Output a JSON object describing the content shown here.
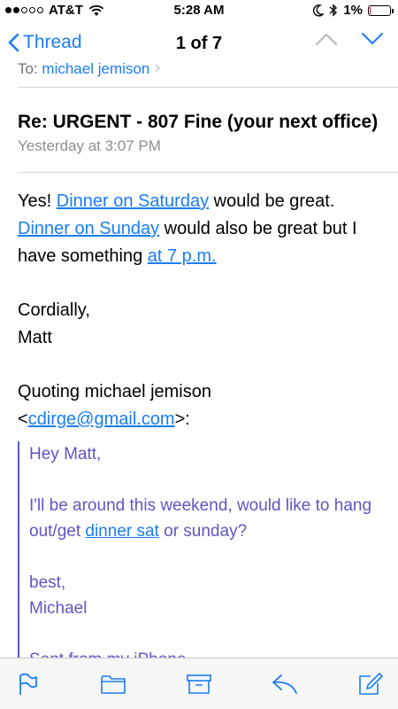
{
  "status_bar": {
    "carrier": "AT&T",
    "time": "5:28 AM",
    "battery": "1%",
    "battery_level": 0.01,
    "battery_color": "#d0021b",
    "signal_bars_filled": 2,
    "icons": [
      "wifi-icon",
      "moon-icon",
      "bluetooth-icon",
      "battery-icon"
    ]
  },
  "nav": {
    "back_label": "Thread",
    "title": "1 of 7",
    "accent": "#1a7cf6"
  },
  "header": {
    "to_prefix": "To: ",
    "to_name": "michael jemison",
    "subject": "Re: URGENT - 807 Fine (your next office)",
    "date": "Yesterday at 3:07 PM"
  },
  "body": {
    "p1_start": "Yes! ",
    "p1_link1": "Dinner on Saturday",
    "p1_mid1": " would be great.",
    "p1_link2": "Dinner on Sunday",
    "p1_mid2": " would also be great but I have something ",
    "p1_link3": "at 7 p.m.",
    "closing": "Cordially,",
    "signature": "Matt",
    "quoting": "Quoting michael jemison",
    "email": "cdirge@gmail.com",
    "email_open": "<",
    "email_close": ">:"
  },
  "quote": {
    "greeting": "Hey Matt,",
    "line_start": "I'll be around this weekend, would like to hang out/get ",
    "line_link": "dinner sat",
    "line_end": " or sunday?",
    "signoff": "best,",
    "name": "Michael",
    "footer": "Sent from my iPhone",
    "color": "#5f56c6"
  },
  "toolbar": {
    "icons": [
      "flag-icon",
      "folder-icon",
      "archive-icon",
      "reply-icon",
      "compose-icon"
    ]
  }
}
